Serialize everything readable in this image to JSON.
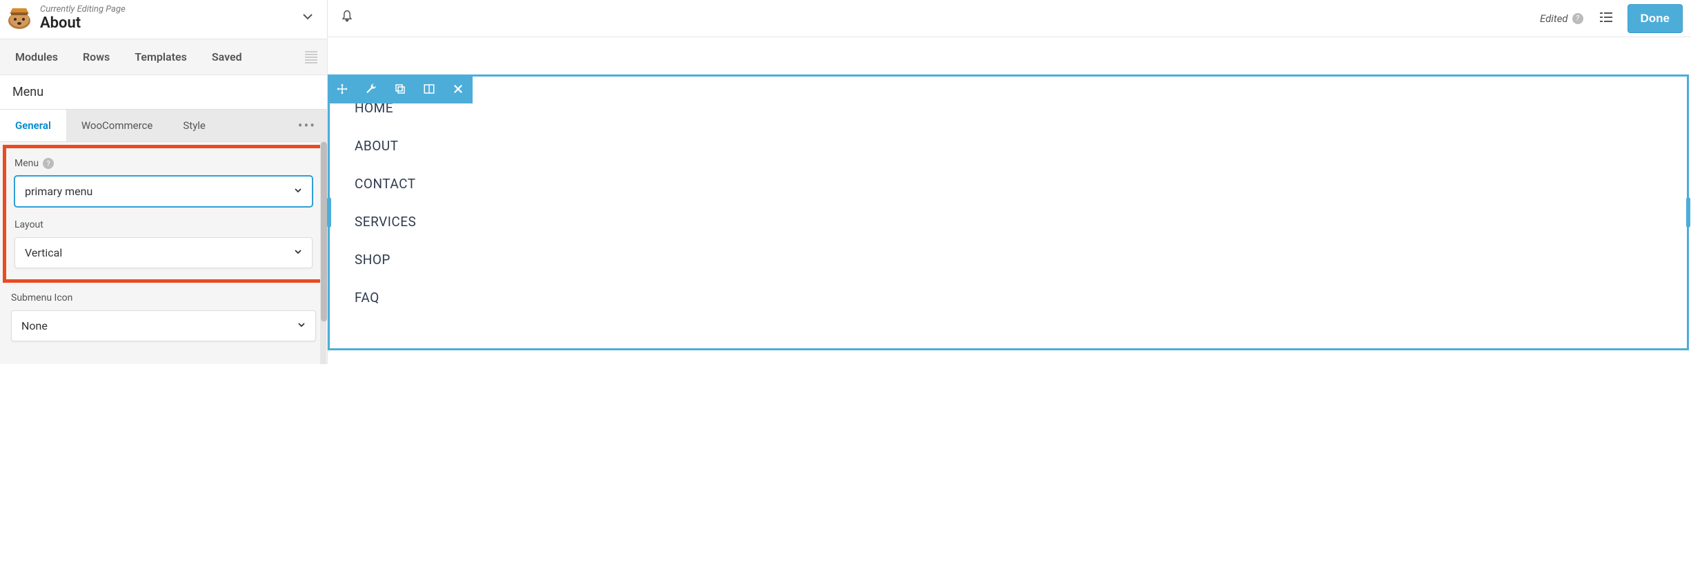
{
  "header": {
    "sup": "Currently Editing Page",
    "title": "About"
  },
  "top_tabs": [
    "Modules",
    "Rows",
    "Templates",
    "Saved"
  ],
  "module_title": "Menu",
  "sub_tabs": [
    "General",
    "WooCommerce",
    "Style"
  ],
  "fields": {
    "menu_label": "Menu",
    "menu_value": "primary menu",
    "layout_label": "Layout",
    "layout_value": "Vertical",
    "submenu_label": "Submenu Icon",
    "submenu_value": "None"
  },
  "topbar": {
    "edited": "Edited",
    "done": "Done"
  },
  "menu_items": [
    "HOME",
    "ABOUT",
    "CONTACT",
    "SERVICES",
    "SHOP",
    "FAQ"
  ]
}
